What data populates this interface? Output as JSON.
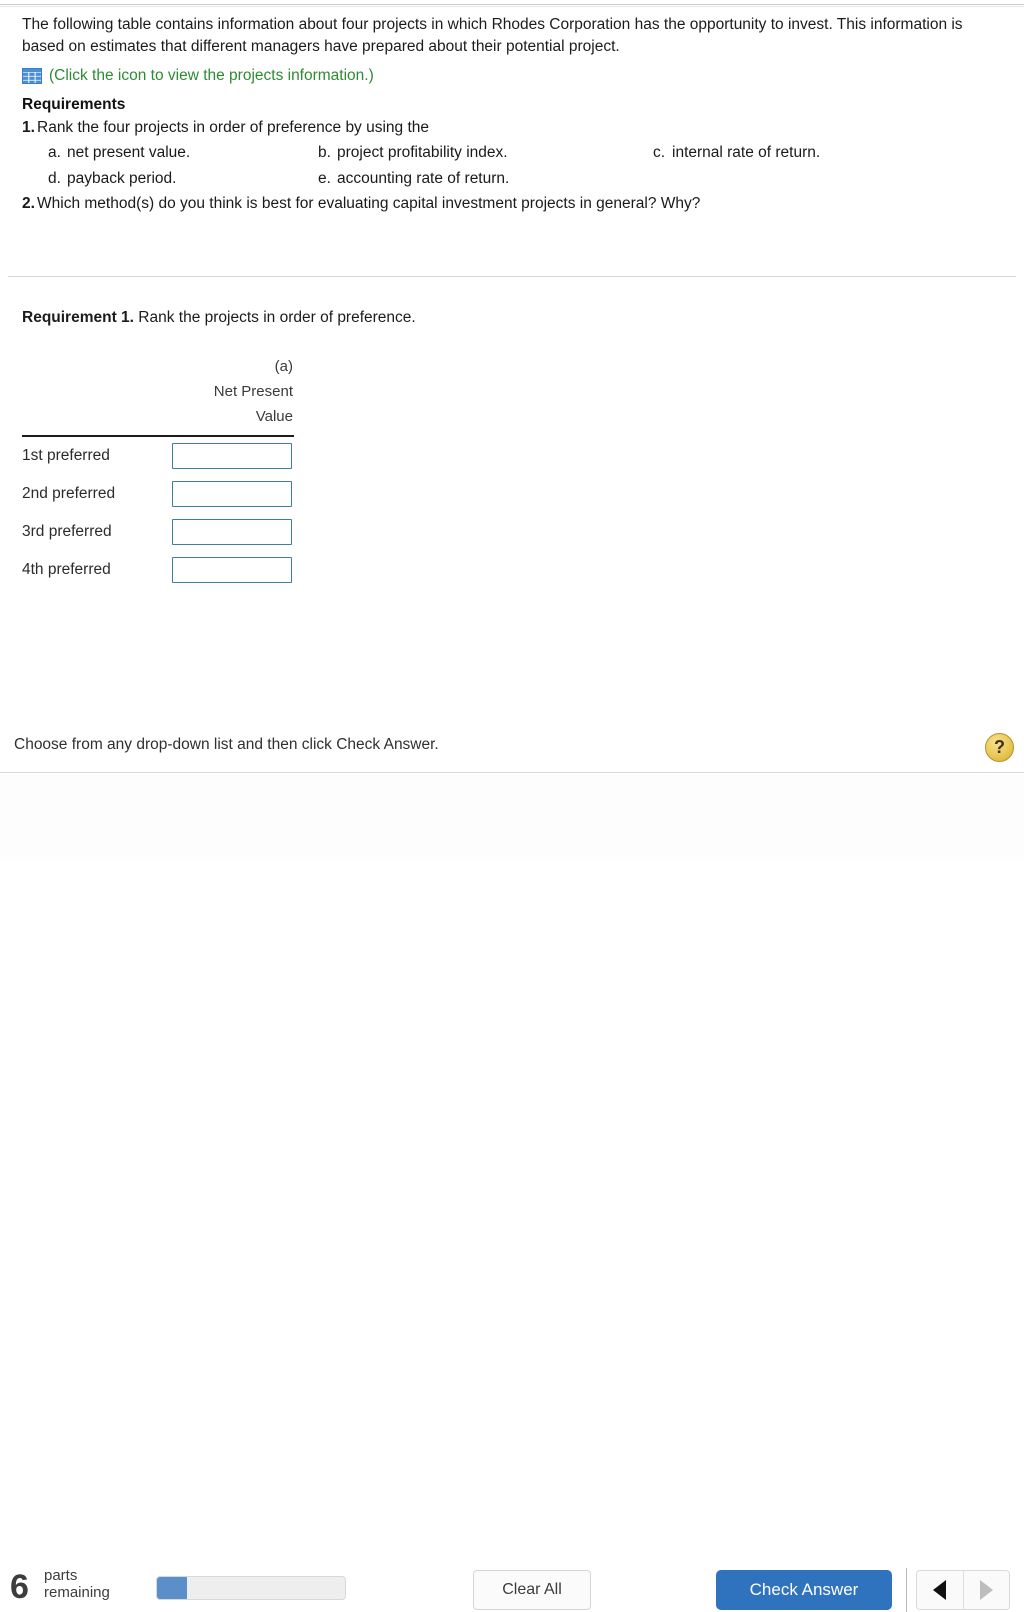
{
  "question": {
    "intro": "The following table contains information about four projects in which Rhodes Corporation has the opportunity to invest. This information is based on estimates that different managers have prepared about their potential project.",
    "icon_name": "table-grid-icon",
    "icon_link_text": "(Click the icon to view the projects information.)",
    "icon_link_color": "#2e8b33",
    "requirements_heading": "Requirements",
    "requirements": [
      {
        "num": "1.",
        "text": "Rank the four projects in order of preference by using the"
      },
      {
        "num": "2.",
        "text": "Which method(s) do you think is best for evaluating capital investment projects in general? Why?"
      }
    ],
    "sub_items": [
      {
        "letter": "a.",
        "text": "net present value."
      },
      {
        "letter": "b.",
        "text": "project profitability index."
      },
      {
        "letter": "c.",
        "text": "internal rate of return."
      },
      {
        "letter": "d.",
        "text": "payback period."
      },
      {
        "letter": "e.",
        "text": "accounting rate of return."
      }
    ]
  },
  "answer_section": {
    "requirement_label": "Requirement 1.",
    "requirement_text": "Rank the projects in order of preference.",
    "column_header": {
      "tag": "(a)",
      "line1": "Net Present",
      "line2": "Value"
    },
    "rows": [
      {
        "label": "1st preferred",
        "value": ""
      },
      {
        "label": "2nd preferred",
        "value": ""
      },
      {
        "label": "3rd preferred",
        "value": ""
      },
      {
        "label": "4th preferred",
        "value": ""
      }
    ]
  },
  "hint": {
    "text": "Choose from any drop-down list and then click Check Answer.",
    "help_symbol": "?"
  },
  "footer": {
    "parts_count": "6",
    "parts_label_line1": "parts",
    "parts_label_line2": "remaining",
    "progress_percent": 16,
    "clear_label": "Clear All",
    "check_label": "Check Answer",
    "prev_enabled": true,
    "next_enabled": false,
    "accent_blue": "#2f72bd",
    "progress_blue": "#5b8fc9",
    "input_border": "#3c7f9e"
  }
}
